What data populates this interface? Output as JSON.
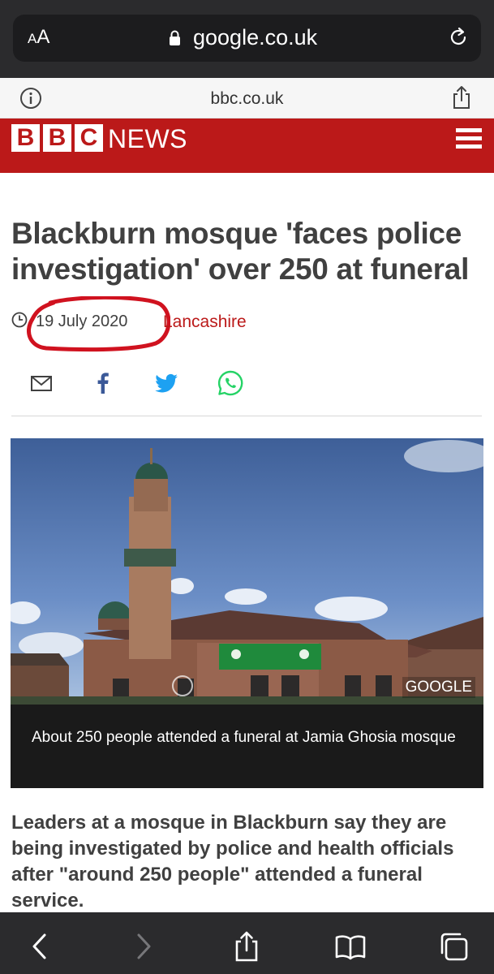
{
  "browser": {
    "text_size_button": {
      "small": "A",
      "large": "A"
    },
    "address": "google.co.uk",
    "site_domain": "bbc.co.uk"
  },
  "header": {
    "logo_letters": [
      "B",
      "B",
      "C"
    ],
    "logo_word": "NEWS"
  },
  "article": {
    "headline": "Blackburn mosque 'faces police investigation' over 250 at funeral",
    "date": "19 July 2020",
    "region": "Lancashire",
    "image_credit": "GOOGLE",
    "caption": "About 250 people attended a funeral at Jamia Ghosia mosque",
    "intro": "Leaders at a mosque in Blackburn say they are being investigated by police and health officials after \"around 250 people\" attended a funeral service."
  },
  "share_icons": [
    "email-icon",
    "facebook-icon",
    "twitter-icon",
    "whatsapp-icon"
  ],
  "toolbar_icons": [
    "back-icon",
    "forward-icon",
    "share-icon",
    "bookmarks-icon",
    "tabs-icon"
  ],
  "colors": {
    "bbc_red": "#bb1919",
    "annotation_red": "#d0121f",
    "facebook": "#3b5998",
    "twitter": "#1da1f2",
    "whatsapp": "#25d366"
  }
}
